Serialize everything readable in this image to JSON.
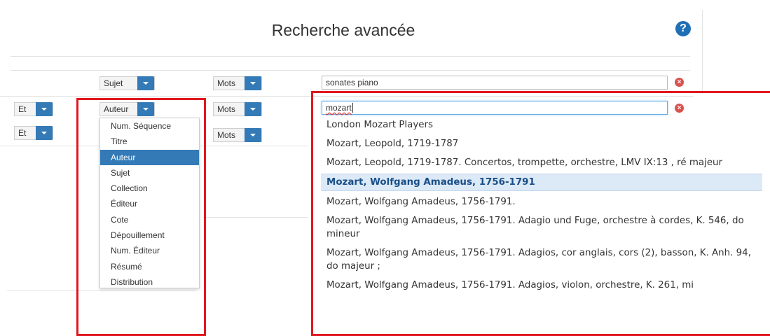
{
  "header": {
    "title": "Recherche avancée",
    "help_icon": "question-circle-icon",
    "help_glyph": "?"
  },
  "rows": [
    {
      "field": "Sujet",
      "mode": "Mots",
      "value": "sonates piano"
    },
    {
      "operator": "Et",
      "field": "Auteur",
      "mode": "Mots",
      "value": "mozart"
    },
    {
      "operator": "Et",
      "mode": "Mots"
    }
  ],
  "clear_glyph": "×",
  "field_menu": {
    "items": [
      "Num. Séquence",
      "Titre",
      "Auteur",
      "Sujet",
      "Collection",
      "Éditeur",
      "Cote",
      "Dépouillement",
      "Num. Éditeur",
      "Résumé",
      "Distribution"
    ],
    "selected": "Auteur"
  },
  "autocomplete": {
    "suggestions": [
      "London Mozart Players",
      "Mozart, Leopold, 1719-1787",
      "Mozart, Leopold, 1719-1787. Concertos, trompette, orchestre, LMV IX:13 , ré majeur",
      "Mozart, Wolfgang Amadeus, 1756-1791",
      "Mozart, Wolfgang Amadeus, 1756-1791.",
      "Mozart, Wolfgang Amadeus, 1756-1791. Adagio und Fuge, orchestre à cordes, K. 546, do mineur",
      "Mozart, Wolfgang Amadeus, 1756-1791. Adagios, cor anglais, cors (2), basson, K. Anh. 94, do majeur ;",
      "Mozart, Wolfgang Amadeus, 1756-1791. Adagios, violon, orchestre, K. 261, mi"
    ],
    "highlighted_index": 3
  },
  "colors": {
    "accent": "#337ab7",
    "highlight_box": "#e0181f",
    "clear": "#d9534f"
  }
}
